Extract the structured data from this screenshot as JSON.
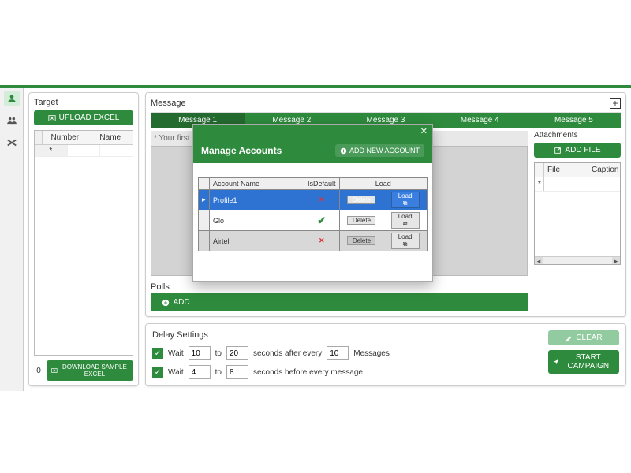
{
  "sidebar": {
    "items": [
      "person",
      "group",
      "tools"
    ]
  },
  "target": {
    "title": "Target",
    "upload_label": "UPLOAD EXCEL",
    "download_label": "DOWNLOAD SAMPLE EXCEL",
    "columns": {
      "number": "Number",
      "name": "Name"
    },
    "row_marker": "*",
    "count": "0"
  },
  "message": {
    "title": "Message",
    "tabs": [
      "Message 1",
      "Message 2",
      "Message 3",
      "Message 4",
      "Message 5"
    ],
    "active_tab": 0,
    "editor_placeholder": "* Your first message",
    "polls_title": "Polls",
    "add_label": "ADD"
  },
  "attachments": {
    "title": "Attachments",
    "add_file_label": "ADD FILE",
    "columns": {
      "file": "File",
      "caption": "Caption"
    },
    "row_marker": "*"
  },
  "delay": {
    "title": "Delay Settings",
    "wait_label": "Wait",
    "to_label": "to",
    "row1": {
      "from": "10",
      "to": "20",
      "after_text": "seconds after every",
      "count": "10",
      "unit": "Messages"
    },
    "row2": {
      "from": "4",
      "to": "8",
      "after_text": "seconds before every message"
    }
  },
  "actions": {
    "clear": "CLEAR",
    "start": "START CAMPAIGN"
  },
  "modal": {
    "title": "Manage Accounts",
    "add_label": "ADD NEW ACCOUNT",
    "columns": {
      "name": "Account Name",
      "is_default": "IsDefault",
      "load": "Load"
    },
    "delete_label": "Delete",
    "load_label": "Load",
    "rows": [
      {
        "name": "Profile1",
        "is_default": false,
        "selected": true
      },
      {
        "name": "Glo",
        "is_default": true,
        "selected": false
      },
      {
        "name": "Airtel",
        "is_default": false,
        "selected": false,
        "hover": true
      }
    ],
    "selected_marker": "▸"
  }
}
